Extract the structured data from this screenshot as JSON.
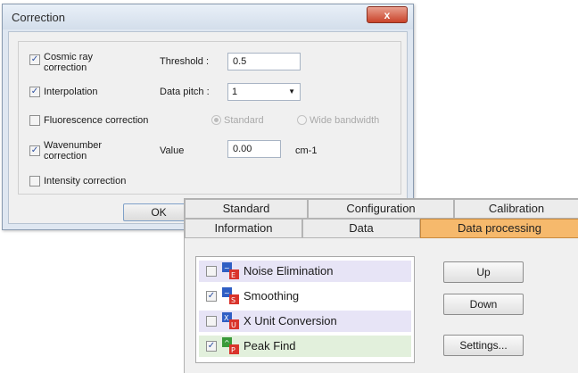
{
  "correction_dialog": {
    "title": "Correction",
    "close_label": "x",
    "cosmic_ray": {
      "label_line1": "Cosmic ray",
      "label_line2": "correction",
      "checked": true,
      "threshold_label": "Threshold :",
      "threshold_value": "0.5"
    },
    "interpolation": {
      "label": "Interpolation",
      "checked": true,
      "data_pitch_label": "Data pitch :",
      "data_pitch_value": "1"
    },
    "fluorescence": {
      "label": "Fluorescence correction",
      "checked": false,
      "radio_standard": "Standard",
      "radio_wide": "Wide bandwidth"
    },
    "wavenumber": {
      "label_line1": "Wavenumber",
      "label_line2": "correction",
      "checked": true,
      "value_label": "Value",
      "value": "0.00",
      "unit": "cm-1"
    },
    "intensity": {
      "label": "Intensity correction",
      "checked": false
    },
    "ok_label": "OK"
  },
  "panel": {
    "tabs_row1": [
      "Standard",
      "Configuration",
      "Calibration"
    ],
    "tabs_row2": [
      "Information",
      "Data",
      "Data processing"
    ],
    "active_tab": "Data processing",
    "items": [
      {
        "label": "Noise Elimination",
        "checked": false
      },
      {
        "label": "Smoothing",
        "checked": true
      },
      {
        "label": "X Unit Conversion",
        "checked": false
      },
      {
        "label": "Peak Find",
        "checked": true
      }
    ],
    "buttons": {
      "up": "Up",
      "down": "Down",
      "settings": "Settings..."
    }
  }
}
